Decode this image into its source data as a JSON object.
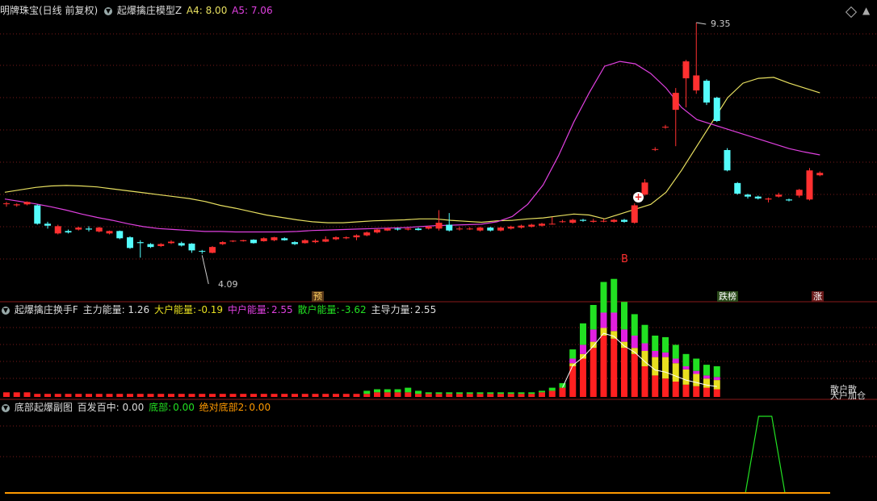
{
  "header_main": {
    "stock": "明牌珠宝(日线 前复权)",
    "indicator": "起爆擒庄模型Z",
    "a4_label": "A4: 8.00",
    "a5_label": "A5: 7.06"
  },
  "header_sub1": {
    "indicator": "起爆擒庄换手F",
    "main_energy": "主力能量: 1.26",
    "big_label": "大户能量:",
    "big_value": "-0.19",
    "mid_label": "中户能量:",
    "mid_value": "2.55",
    "small_label": "散户能量:",
    "small_value": "-3.62",
    "lead_label": "主导力量:",
    "lead_value": "2.55"
  },
  "header_sub2": {
    "indicator": "底部起爆副图",
    "hit_label": "百发百中: 0.00",
    "bottom_label": "底部:",
    "bottom_value": "0.00",
    "abs_label": "绝对底部2:",
    "abs_value": "0.00"
  },
  "markers": {
    "high_label": "9.35",
    "low_label": "4.09",
    "buy_label": "B",
    "tag_pre": "预",
    "tag_rank": "跌榜",
    "tag_zhang": "涨",
    "side_labels": [
      "散户散",
      "大户加仓"
    ]
  },
  "colors": {
    "up": "#ff3030",
    "down": "#54fcfc",
    "ma_yellow": "#e8e060",
    "ma_magenta": "#e040e0",
    "vol_green": "#22e022",
    "vol_magenta": "#e020e0",
    "vol_yellow": "#e8e020",
    "vol_red": "#ff2020",
    "grid": "#7a1a1a"
  },
  "chart_data": {
    "type": "candlestick",
    "price_high": 9.35,
    "price_low": 4.09,
    "candles": [
      {
        "o": 5.62,
        "c": 5.62,
        "h": 5.65,
        "l": 5.55
      },
      {
        "o": 5.58,
        "c": 5.6,
        "h": 5.62,
        "l": 5.55
      },
      {
        "o": 5.6,
        "c": 5.65,
        "h": 5.66,
        "l": 5.58
      },
      {
        "o": 5.58,
        "c": 5.2,
        "h": 5.6,
        "l": 5.18
      },
      {
        "o": 5.2,
        "c": 5.16,
        "h": 5.24,
        "l": 5.1
      },
      {
        "o": 5.0,
        "c": 5.15,
        "h": 5.18,
        "l": 4.98
      },
      {
        "o": 5.05,
        "c": 5.02,
        "h": 5.08,
        "l": 5.0
      },
      {
        "o": 5.08,
        "c": 5.12,
        "h": 5.14,
        "l": 5.06
      },
      {
        "o": 5.1,
        "c": 5.08,
        "h": 5.15,
        "l": 5.04
      },
      {
        "o": 5.04,
        "c": 5.12,
        "h": 5.14,
        "l": 5.02
      },
      {
        "o": 5.0,
        "c": 5.05,
        "h": 5.06,
        "l": 4.98
      },
      {
        "o": 5.05,
        "c": 4.9,
        "h": 5.06,
        "l": 4.88
      },
      {
        "o": 4.92,
        "c": 4.7,
        "h": 4.94,
        "l": 4.68
      },
      {
        "o": 4.82,
        "c": 4.8,
        "h": 4.86,
        "l": 4.5
      },
      {
        "o": 4.78,
        "c": 4.72,
        "h": 4.8,
        "l": 4.7
      },
      {
        "o": 4.74,
        "c": 4.78,
        "h": 4.8,
        "l": 4.72
      },
      {
        "o": 4.8,
        "c": 4.83,
        "h": 4.86,
        "l": 4.78
      },
      {
        "o": 4.8,
        "c": 4.75,
        "h": 4.83,
        "l": 4.73
      },
      {
        "o": 4.79,
        "c": 4.65,
        "h": 4.8,
        "l": 4.6
      },
      {
        "o": 4.64,
        "c": 4.63,
        "h": 4.66,
        "l": 4.58
      },
      {
        "o": 4.6,
        "c": 4.72,
        "h": 4.74,
        "l": 4.59
      },
      {
        "o": 4.78,
        "c": 4.82,
        "h": 4.84,
        "l": 4.76
      },
      {
        "o": 4.84,
        "c": 4.85,
        "h": 4.86,
        "l": 4.82
      },
      {
        "o": 4.84,
        "c": 4.86,
        "h": 4.87,
        "l": 4.83
      },
      {
        "o": 4.87,
        "c": 4.8,
        "h": 4.88,
        "l": 4.79
      },
      {
        "o": 4.84,
        "c": 4.9,
        "h": 4.92,
        "l": 4.83
      },
      {
        "o": 4.86,
        "c": 4.92,
        "h": 4.93,
        "l": 4.84
      },
      {
        "o": 4.9,
        "c": 4.86,
        "h": 4.92,
        "l": 4.85
      },
      {
        "o": 4.82,
        "c": 4.78,
        "h": 4.84,
        "l": 4.76
      },
      {
        "o": 4.8,
        "c": 4.86,
        "h": 4.88,
        "l": 4.79
      },
      {
        "o": 4.82,
        "c": 4.85,
        "h": 4.88,
        "l": 4.8
      },
      {
        "o": 4.83,
        "c": 4.88,
        "h": 4.94,
        "l": 4.82
      },
      {
        "o": 4.88,
        "c": 4.92,
        "h": 4.94,
        "l": 4.86
      },
      {
        "o": 4.9,
        "c": 4.92,
        "h": 4.94,
        "l": 4.88
      },
      {
        "o": 4.92,
        "c": 4.96,
        "h": 4.98,
        "l": 4.86
      },
      {
        "o": 4.96,
        "c": 5.02,
        "h": 5.04,
        "l": 4.94
      },
      {
        "o": 5.02,
        "c": 5.08,
        "h": 5.1,
        "l": 5.0
      },
      {
        "o": 5.06,
        "c": 5.1,
        "h": 5.12,
        "l": 5.05
      },
      {
        "o": 5.1,
        "c": 5.08,
        "h": 5.12,
        "l": 5.06
      },
      {
        "o": 5.08,
        "c": 5.1,
        "h": 5.12,
        "l": 5.06
      },
      {
        "o": 5.1,
        "c": 5.07,
        "h": 5.12,
        "l": 5.06
      },
      {
        "o": 5.1,
        "c": 5.14,
        "h": 5.16,
        "l": 5.08
      },
      {
        "o": 5.1,
        "c": 5.22,
        "h": 5.48,
        "l": 5.06
      },
      {
        "o": 5.18,
        "c": 5.06,
        "h": 5.42,
        "l": 5.04
      },
      {
        "o": 5.1,
        "c": 5.1,
        "h": 5.14,
        "l": 5.06
      },
      {
        "o": 5.1,
        "c": 5.1,
        "h": 5.13,
        "l": 5.07
      },
      {
        "o": 5.06,
        "c": 5.12,
        "h": 5.14,
        "l": 5.04
      },
      {
        "o": 5.12,
        "c": 5.06,
        "h": 5.14,
        "l": 5.04
      },
      {
        "o": 5.06,
        "c": 5.12,
        "h": 5.14,
        "l": 5.04
      },
      {
        "o": 5.1,
        "c": 5.14,
        "h": 5.16,
        "l": 5.08
      },
      {
        "o": 5.12,
        "c": 5.16,
        "h": 5.18,
        "l": 5.1
      },
      {
        "o": 5.14,
        "c": 5.18,
        "h": 5.2,
        "l": 5.12
      },
      {
        "o": 5.16,
        "c": 5.2,
        "h": 5.22,
        "l": 5.14
      },
      {
        "o": 5.2,
        "c": 5.2,
        "h": 5.34,
        "l": 5.18
      },
      {
        "o": 5.24,
        "c": 5.25,
        "h": 5.28,
        "l": 5.22
      },
      {
        "o": 5.22,
        "c": 5.28,
        "h": 5.3,
        "l": 5.2
      },
      {
        "o": 5.28,
        "c": 5.26,
        "h": 5.3,
        "l": 5.24
      },
      {
        "o": 5.24,
        "c": 5.26,
        "h": 5.3,
        "l": 5.22
      },
      {
        "o": 5.26,
        "c": 5.26,
        "h": 5.3,
        "l": 5.23
      },
      {
        "o": 5.24,
        "c": 5.28,
        "h": 5.3,
        "l": 5.22
      },
      {
        "o": 5.28,
        "c": 5.24,
        "h": 5.3,
        "l": 5.22
      },
      {
        "o": 5.22,
        "c": 5.58,
        "h": 5.62,
        "l": 5.2
      },
      {
        "o": 5.8,
        "c": 6.05,
        "h": 6.12,
        "l": 5.78
      },
      {
        "o": 6.74,
        "c": 6.74,
        "h": 6.78,
        "l": 6.7
      },
      {
        "o": 7.2,
        "c": 7.2,
        "h": 7.24,
        "l": 7.16
      },
      {
        "o": 7.55,
        "c": 7.9,
        "h": 8.0,
        "l": 6.8
      },
      {
        "o": 8.2,
        "c": 8.55,
        "h": 8.58,
        "l": 7.6
      },
      {
        "o": 7.95,
        "c": 8.26,
        "h": 9.35,
        "l": 7.88
      },
      {
        "o": 8.15,
        "c": 7.7,
        "h": 8.18,
        "l": 7.65
      },
      {
        "o": 7.8,
        "c": 7.32,
        "h": 7.82,
        "l": 7.3
      },
      {
        "o": 6.72,
        "c": 6.3,
        "h": 6.76,
        "l": 6.28
      },
      {
        "o": 6.04,
        "c": 5.82,
        "h": 6.06,
        "l": 5.8
      },
      {
        "o": 5.8,
        "c": 5.76,
        "h": 5.82,
        "l": 5.72
      },
      {
        "o": 5.76,
        "c": 5.72,
        "h": 5.78,
        "l": 5.7
      },
      {
        "o": 5.7,
        "c": 5.72,
        "h": 5.74,
        "l": 5.64
      },
      {
        "o": 5.76,
        "c": 5.8,
        "h": 5.84,
        "l": 5.74
      },
      {
        "o": 5.7,
        "c": 5.68,
        "h": 5.72,
        "l": 5.66
      },
      {
        "o": 5.78,
        "c": 5.9,
        "h": 5.92,
        "l": 5.74
      },
      {
        "o": 5.7,
        "c": 6.3,
        "h": 6.35,
        "l": 5.68
      },
      {
        "o": 6.2,
        "c": 6.25,
        "h": 6.28,
        "l": 6.18
      }
    ],
    "ma_yellow": [
      5.85,
      5.9,
      5.95,
      5.98,
      5.99,
      5.98,
      5.96,
      5.92,
      5.88,
      5.84,
      5.8,
      5.76,
      5.72,
      5.66,
      5.58,
      5.52,
      5.45,
      5.38,
      5.33,
      5.28,
      5.24,
      5.22,
      5.22,
      5.24,
      5.26,
      5.27,
      5.28,
      5.3,
      5.3,
      5.27,
      5.25,
      5.23,
      5.26,
      5.27,
      5.3,
      5.32,
      5.36,
      5.4,
      5.38,
      5.3,
      5.4,
      5.5,
      5.6,
      5.85,
      6.3,
      6.8,
      7.3,
      7.8,
      8.1,
      8.2,
      8.22,
      8.1,
      8.0,
      7.9
    ],
    "ma_magenta": [
      5.71,
      5.66,
      5.61,
      5.55,
      5.48,
      5.4,
      5.33,
      5.27,
      5.2,
      5.14,
      5.1,
      5.08,
      5.06,
      5.04,
      5.04,
      5.03,
      5.03,
      5.03,
      5.03,
      5.04,
      5.06,
      5.07,
      5.08,
      5.09,
      5.1,
      5.11,
      5.12,
      5.14,
      5.16,
      5.17,
      5.18,
      5.19,
      5.24,
      5.35,
      5.6,
      6.0,
      6.6,
      7.3,
      7.9,
      8.45,
      8.55,
      8.5,
      8.3,
      8.0,
      7.6,
      7.35,
      7.25,
      7.15,
      7.05,
      6.95,
      6.85,
      6.75,
      6.68,
      6.62
    ],
    "vol": [
      {
        "g": 0,
        "m": 0,
        "y": 0,
        "r": 3
      },
      {
        "g": 0,
        "m": 0,
        "y": 0,
        "r": 3
      },
      {
        "g": 0,
        "m": 0,
        "y": 0,
        "r": 3
      },
      {
        "g": 0,
        "m": 0,
        "y": 0,
        "r": 2
      },
      {
        "g": 0,
        "m": 0,
        "y": 0,
        "r": 2
      },
      {
        "g": 0,
        "m": 0,
        "y": 0,
        "r": 2
      },
      {
        "g": 0,
        "m": 0,
        "y": 0,
        "r": 2
      },
      {
        "g": 0,
        "m": 0,
        "y": 0,
        "r": 2
      },
      {
        "g": 0,
        "m": 0,
        "y": 0,
        "r": 2
      },
      {
        "g": 0,
        "m": 0,
        "y": 0,
        "r": 2
      },
      {
        "g": 0,
        "m": 0,
        "y": 0,
        "r": 2
      },
      {
        "g": 0,
        "m": 0,
        "y": 0,
        "r": 2
      },
      {
        "g": 0,
        "m": 0,
        "y": 0,
        "r": 2
      },
      {
        "g": 0,
        "m": 0,
        "y": 0,
        "r": 2
      },
      {
        "g": 0,
        "m": 0,
        "y": 0,
        "r": 2
      },
      {
        "g": 0,
        "m": 0,
        "y": 0,
        "r": 2
      },
      {
        "g": 0,
        "m": 0,
        "y": 0,
        "r": 2
      },
      {
        "g": 0,
        "m": 0,
        "y": 0,
        "r": 2
      },
      {
        "g": 0,
        "m": 0,
        "y": 0,
        "r": 2
      },
      {
        "g": 0,
        "m": 0,
        "y": 0,
        "r": 2
      },
      {
        "g": 0,
        "m": 0,
        "y": 0,
        "r": 2
      },
      {
        "g": 0,
        "m": 0,
        "y": 0,
        "r": 2
      },
      {
        "g": 0,
        "m": 0,
        "y": 0,
        "r": 2
      },
      {
        "g": 0,
        "m": 0,
        "y": 0,
        "r": 2
      },
      {
        "g": 0,
        "m": 0,
        "y": 0,
        "r": 2
      },
      {
        "g": 0,
        "m": 0,
        "y": 0,
        "r": 2
      },
      {
        "g": 0,
        "m": 0,
        "y": 0,
        "r": 2
      },
      {
        "g": 0,
        "m": 0,
        "y": 0,
        "r": 2
      },
      {
        "g": 0,
        "m": 0,
        "y": 0,
        "r": 2
      },
      {
        "g": 0,
        "m": 0,
        "y": 0,
        "r": 2
      },
      {
        "g": 0,
        "m": 0,
        "y": 0,
        "r": 2
      },
      {
        "g": 0,
        "m": 0,
        "y": 0,
        "r": 2
      },
      {
        "g": 0,
        "m": 0,
        "y": 0,
        "r": 2
      },
      {
        "g": 0,
        "m": 0,
        "y": 0,
        "r": 2
      },
      {
        "g": 0,
        "m": 0,
        "y": 0,
        "r": 2
      },
      {
        "g": 2,
        "m": 0,
        "y": 0,
        "r": 2
      },
      {
        "g": 2,
        "m": 0,
        "y": 0,
        "r": 3
      },
      {
        "g": 2,
        "m": 0,
        "y": 0,
        "r": 3
      },
      {
        "g": 2,
        "m": 0,
        "y": 0,
        "r": 3
      },
      {
        "g": 3,
        "m": 0,
        "y": 0,
        "r": 3
      },
      {
        "g": 2,
        "m": 0,
        "y": 0,
        "r": 2
      },
      {
        "g": 1,
        "m": 0,
        "y": 0,
        "r": 2
      },
      {
        "g": 1,
        "m": 0,
        "y": 0,
        "r": 2
      },
      {
        "g": 1,
        "m": 0,
        "y": 0,
        "r": 2
      },
      {
        "g": 1,
        "m": 0,
        "y": 0,
        "r": 2
      },
      {
        "g": 1,
        "m": 0,
        "y": 0,
        "r": 2
      },
      {
        "g": 1,
        "m": 0,
        "y": 0,
        "r": 2
      },
      {
        "g": 1,
        "m": 0,
        "y": 0,
        "r": 2
      },
      {
        "g": 1,
        "m": 0,
        "y": 0,
        "r": 2
      },
      {
        "g": 1,
        "m": 0,
        "y": 0,
        "r": 2
      },
      {
        "g": 1,
        "m": 0,
        "y": 0,
        "r": 2
      },
      {
        "g": 1,
        "m": 0,
        "y": 0,
        "r": 2
      },
      {
        "g": 1,
        "m": 0,
        "y": 0,
        "r": 3
      },
      {
        "g": 2,
        "m": 0,
        "y": 0,
        "r": 4
      },
      {
        "g": 3,
        "m": 0,
        "y": 0,
        "r": 6
      },
      {
        "g": 6,
        "m": 3,
        "y": 2,
        "r": 20
      },
      {
        "g": 14,
        "m": 6,
        "y": 3,
        "r": 25
      },
      {
        "g": 16,
        "m": 8,
        "y": 4,
        "r": 32
      },
      {
        "g": 20,
        "m": 10,
        "y": 5,
        "r": 40
      },
      {
        "g": 22,
        "m": 12,
        "y": 5,
        "r": 38
      },
      {
        "g": 18,
        "m": 8,
        "y": 4,
        "r": 32
      },
      {
        "g": 14,
        "m": 8,
        "y": 4,
        "r": 28
      },
      {
        "g": 12,
        "m": 5,
        "y": 10,
        "r": 20
      },
      {
        "g": 10,
        "m": 4,
        "y": 12,
        "r": 14
      },
      {
        "g": 10,
        "m": 3,
        "y": 14,
        "r": 12
      },
      {
        "g": 9,
        "m": 3,
        "y": 12,
        "r": 10
      },
      {
        "g": 8,
        "m": 2,
        "y": 10,
        "r": 8
      },
      {
        "g": 8,
        "m": 2,
        "y": 8,
        "r": 7
      },
      {
        "g": 7,
        "m": 2,
        "y": 6,
        "r": 6
      },
      {
        "g": 7,
        "m": 2,
        "y": 6,
        "r": 5
      }
    ],
    "bottom_signal": {
      "type": "line",
      "x": [
        0.85,
        0.865,
        0.88,
        0.895
      ],
      "y": [
        0,
        1,
        1,
        0
      ]
    }
  }
}
